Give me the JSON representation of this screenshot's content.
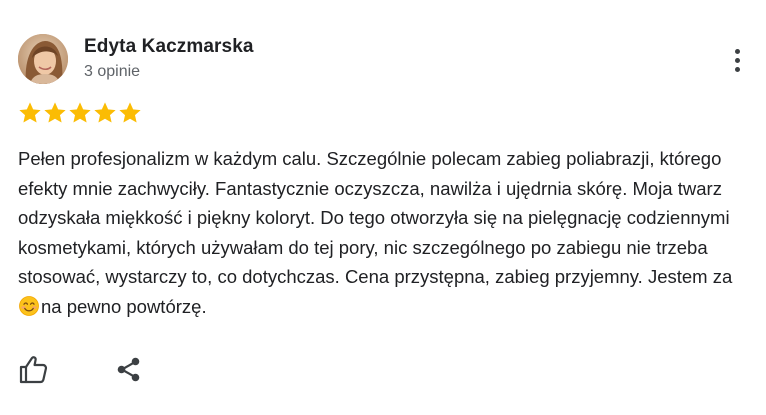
{
  "review": {
    "reviewer_name": "Edyta Kaczmarska",
    "review_count": "3 opinie",
    "rating": 5,
    "rating_max": 5,
    "star_color": "#fbbc04",
    "text_before_emoji": "Pełen profesjonalizm w każdym calu. Szczególnie polecam zabieg poliabrazji, którego efekty mnie zachwyciły. Fantastycznie oczyszcza, nawilża i ujędrnia skórę. Moja twarz odzyskała miękkość i piękny koloryt. Do tego otworzyła się na pielęgnację codziennymi kosmetykami, których używałam do tej pory, nic szczególnego po zabiegu nie trzeba stosować, wystarczy to, co dotychczas. Cena przystępna, zabieg przyjemny. Jestem za ",
    "emoji": "smiling-face-icon",
    "text_after_emoji": "na pewno powtórzę."
  },
  "actions": {
    "more_icon": "more-vert-icon",
    "like_icon": "thumb-up-icon",
    "share_icon": "share-icon"
  }
}
